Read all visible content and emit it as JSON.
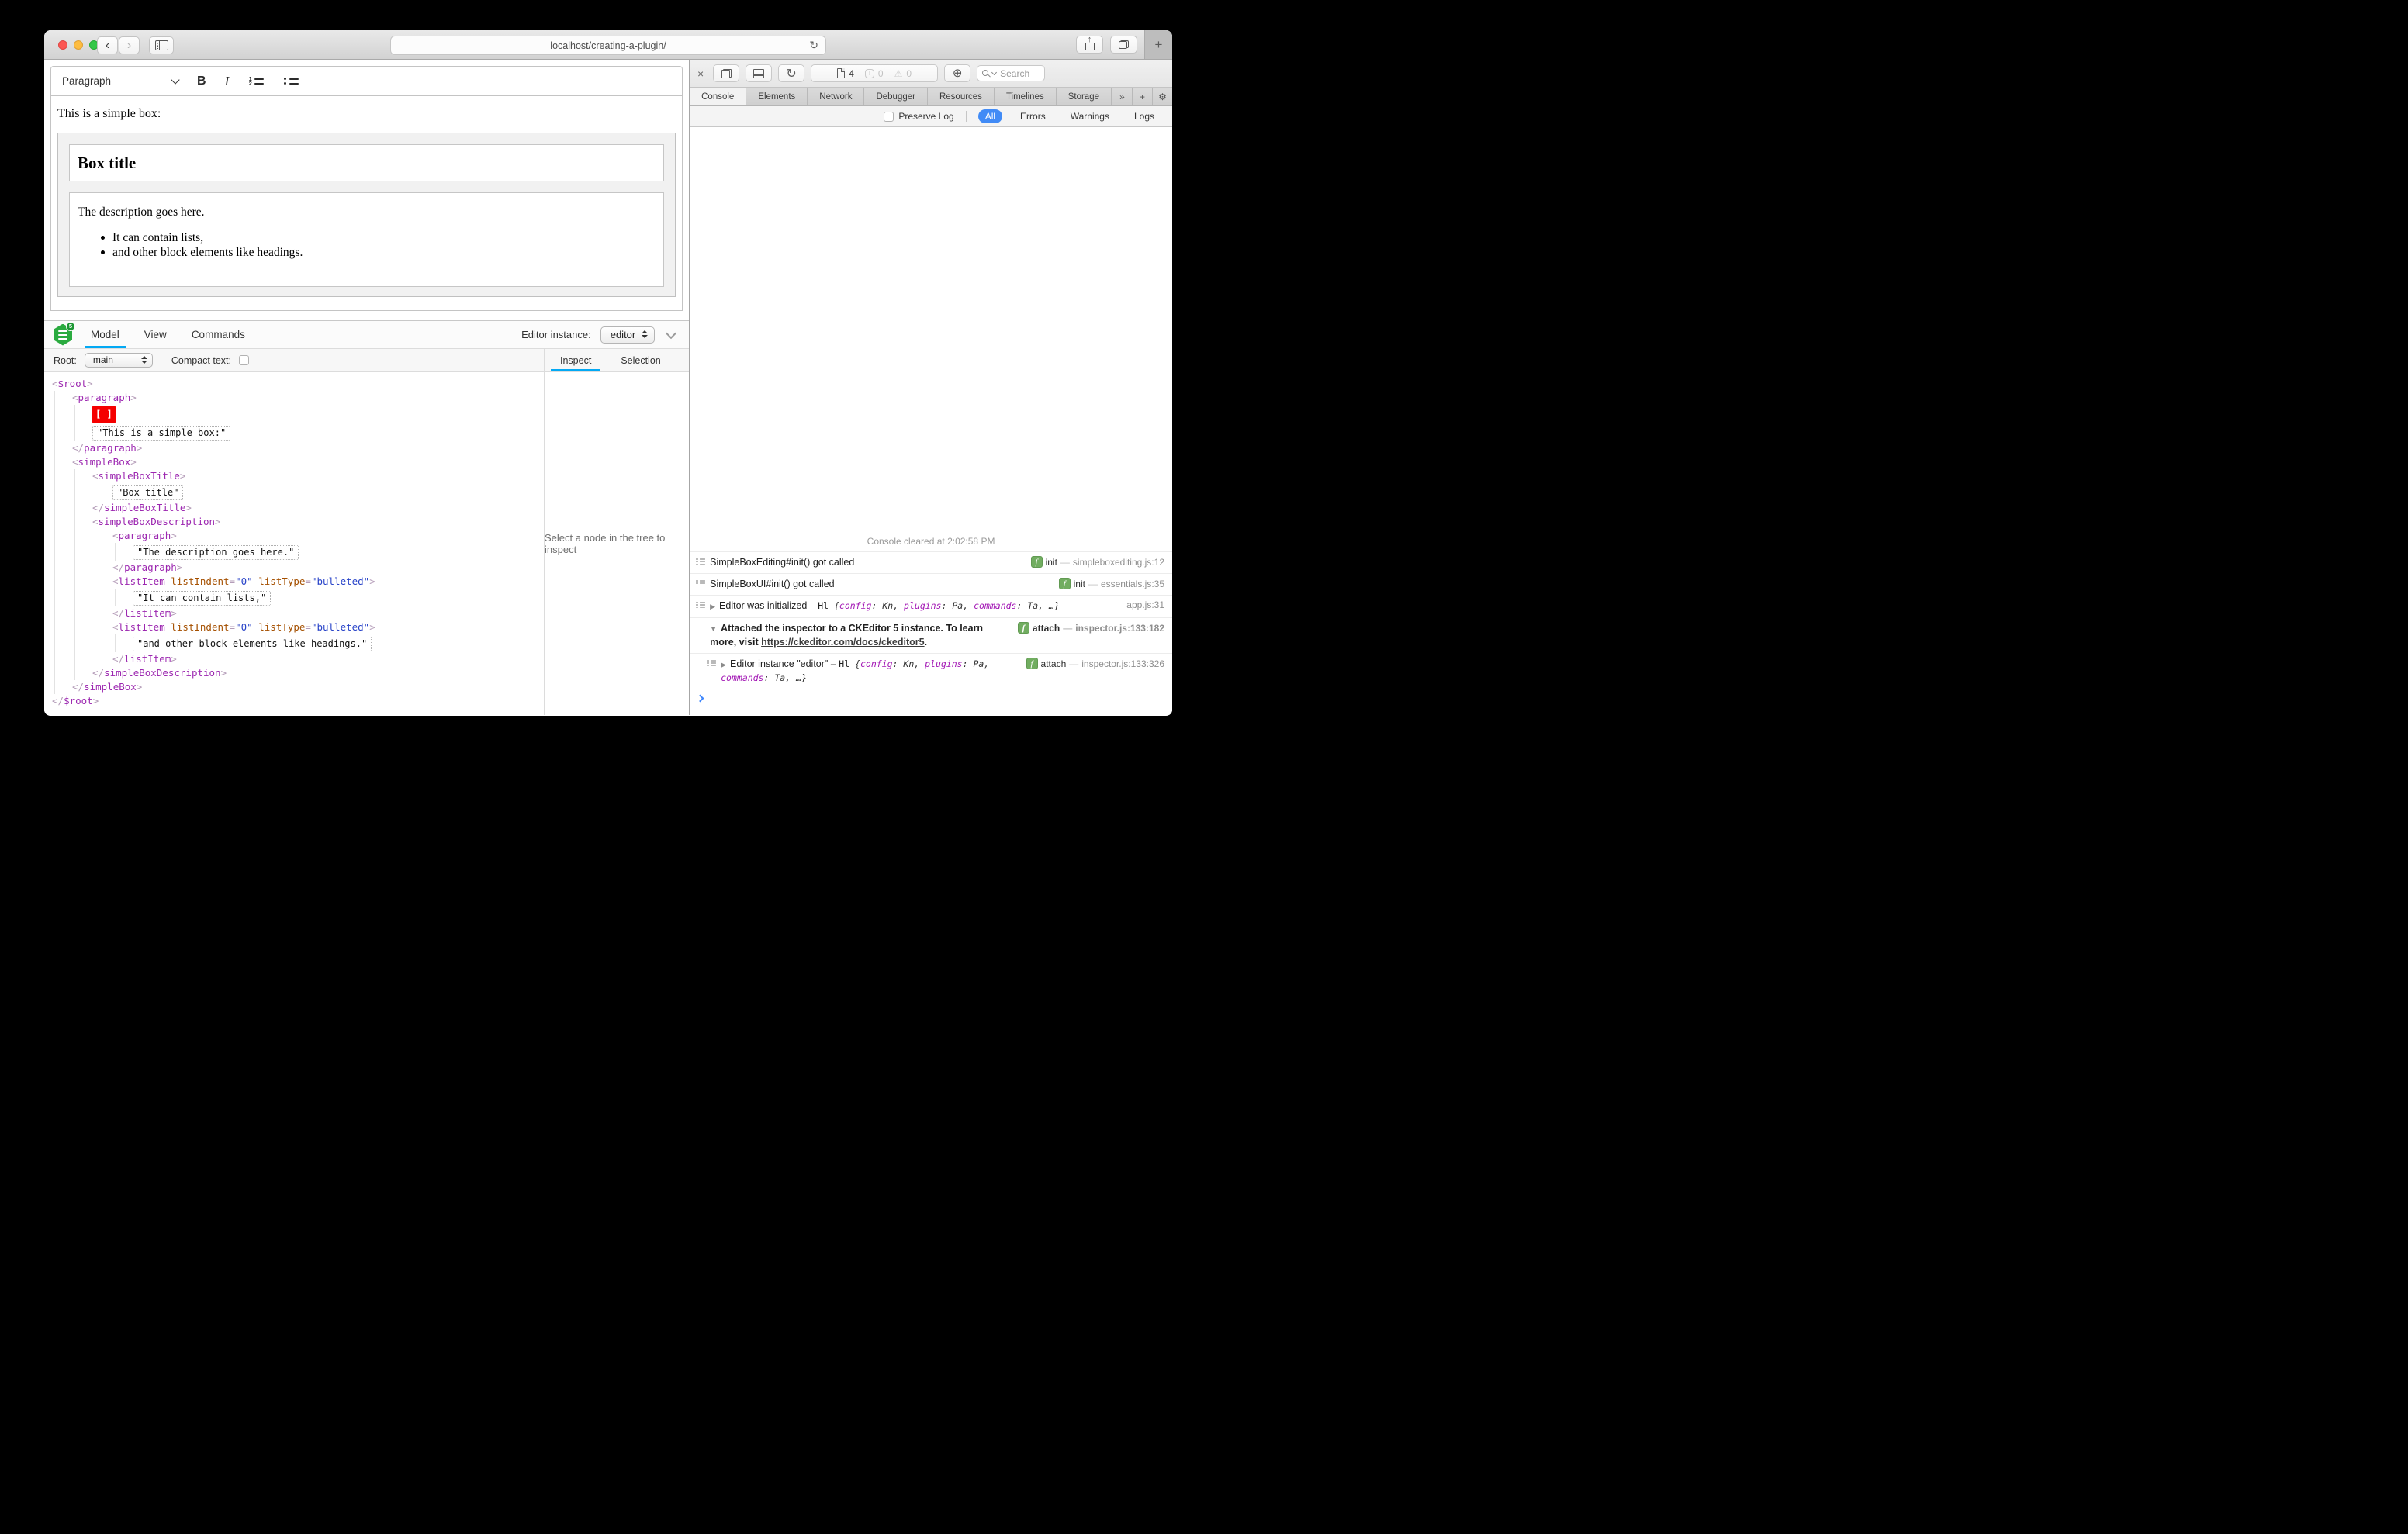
{
  "window": {
    "url": "localhost/creating-a-plugin/",
    "new_tab_label": "+"
  },
  "colors": {
    "accent_blue": "#418bf6",
    "tab_underline_blue": "#03a9f4",
    "selection_red": "#f50000",
    "tag_purple": "#9c27b0",
    "attr_orange": "#a55000",
    "value_blue": "#2742c8",
    "badge_green": "#71ad60",
    "ck_green": "#2bab40"
  },
  "editor": {
    "toolbar": {
      "paragraph_label": "Paragraph",
      "bold_label": "B",
      "italic_label": "I"
    },
    "content": {
      "intro": "This is a simple box:",
      "box_title": "Box title",
      "description": "The description goes here.",
      "bullets": [
        "It can contain lists,",
        "and other block elements like headings."
      ]
    }
  },
  "ck_inspector": {
    "logo_badge": "5",
    "tabs": [
      "Model",
      "View",
      "Commands"
    ],
    "active_tab": "Model",
    "editor_instance_label": "Editor instance:",
    "editor_instance_value": "editor",
    "root_label": "Root:",
    "root_value": "main",
    "compact_label": "Compact text:",
    "side_tabs": [
      "Inspect",
      "Selection"
    ],
    "active_side_tab": "Inspect",
    "empty_message": "Select a node in the tree to inspect",
    "selection_marker": "[ ]",
    "model_tree": [
      {
        "indent": 0,
        "kind": "open",
        "tag": "$root"
      },
      {
        "indent": 1,
        "kind": "open",
        "tag": "paragraph"
      },
      {
        "indent": 2,
        "kind": "selection"
      },
      {
        "indent": 2,
        "kind": "text",
        "value": "This is a simple box:"
      },
      {
        "indent": 1,
        "kind": "close",
        "tag": "paragraph"
      },
      {
        "indent": 1,
        "kind": "open",
        "tag": "simpleBox"
      },
      {
        "indent": 2,
        "kind": "open",
        "tag": "simpleBoxTitle"
      },
      {
        "indent": 3,
        "kind": "text",
        "value": "Box title"
      },
      {
        "indent": 2,
        "kind": "close",
        "tag": "simpleBoxTitle"
      },
      {
        "indent": 2,
        "kind": "open",
        "tag": "simpleBoxDescription"
      },
      {
        "indent": 3,
        "kind": "open",
        "tag": "paragraph"
      },
      {
        "indent": 4,
        "kind": "text",
        "value": "The description goes here."
      },
      {
        "indent": 3,
        "kind": "close",
        "tag": "paragraph"
      },
      {
        "indent": 3,
        "kind": "open",
        "tag": "listItem",
        "attrs": [
          [
            "listIndent",
            "0"
          ],
          [
            "listType",
            "bulleted"
          ]
        ]
      },
      {
        "indent": 4,
        "kind": "text",
        "value": "It can contain lists,"
      },
      {
        "indent": 3,
        "kind": "close",
        "tag": "listItem"
      },
      {
        "indent": 3,
        "kind": "open",
        "tag": "listItem",
        "attrs": [
          [
            "listIndent",
            "0"
          ],
          [
            "listType",
            "bulleted"
          ]
        ]
      },
      {
        "indent": 4,
        "kind": "text",
        "value": "and other block elements like headings."
      },
      {
        "indent": 3,
        "kind": "close",
        "tag": "listItem"
      },
      {
        "indent": 2,
        "kind": "close",
        "tag": "simpleBoxDescription"
      },
      {
        "indent": 1,
        "kind": "close",
        "tag": "simpleBox"
      },
      {
        "indent": 0,
        "kind": "close",
        "tag": "$root"
      }
    ]
  },
  "devtools": {
    "toolbar": {
      "resource_count": "4",
      "error_count": "0",
      "warning_count": "0",
      "search_placeholder": "Search"
    },
    "tabs": [
      "Console",
      "Elements",
      "Network",
      "Debugger",
      "Resources",
      "Timelines",
      "Storage"
    ],
    "active_tab": "Console",
    "filters": {
      "preserve_log_label": "Preserve Log",
      "options": [
        "All",
        "Errors",
        "Warnings",
        "Logs"
      ],
      "active": "All"
    },
    "console": {
      "cleared": "Console cleared at 2:02:58 PM",
      "rows": [
        {
          "icon": true,
          "segments": [
            {
              "k": "plain",
              "v": "SimpleBoxEditing#init() got called"
            }
          ],
          "badge": "init",
          "source": "simpleboxediting.js:12"
        },
        {
          "icon": true,
          "segments": [
            {
              "k": "plain",
              "v": "SimpleBoxUI#init() got called"
            }
          ],
          "badge": "init",
          "source": "essentials.js:35"
        },
        {
          "icon": true,
          "disclosure": "closed",
          "segments": [
            {
              "k": "plain",
              "v": "Editor was initialized"
            },
            {
              "k": "dim",
              "v": " – "
            },
            {
              "k": "cls",
              "v": "Hl "
            },
            {
              "k": "code",
              "v": "{"
            },
            {
              "k": "key",
              "v": "config"
            },
            {
              "k": "code",
              "v": ": "
            },
            {
              "k": "ival",
              "v": "Kn"
            },
            {
              "k": "code",
              "v": ", "
            },
            {
              "k": "key",
              "v": "plugins"
            },
            {
              "k": "code",
              "v": ": "
            },
            {
              "k": "ival",
              "v": "Pa"
            },
            {
              "k": "code",
              "v": ", "
            },
            {
              "k": "key",
              "v": "commands"
            },
            {
              "k": "code",
              "v": ": "
            },
            {
              "k": "ival",
              "v": "Ta"
            },
            {
              "k": "code",
              "v": ", …}"
            }
          ],
          "source": "app.js:31"
        },
        {
          "disclosure": "open",
          "bold": true,
          "segments": [
            {
              "k": "plain",
              "v": "Attached the inspector to a CKEditor 5 instance. To learn more, visit "
            },
            {
              "k": "link",
              "v": "https://ckeditor.com/docs/ckeditor5"
            },
            {
              "k": "plain",
              "v": "."
            }
          ],
          "badge": "attach",
          "source": "inspector.js:133:182"
        },
        {
          "icon": true,
          "nested": true,
          "disclosure": "closed",
          "segments": [
            {
              "k": "plain",
              "v": "Editor instance \"editor\""
            },
            {
              "k": "dim",
              "v": " – "
            },
            {
              "k": "cls",
              "v": "Hl "
            },
            {
              "k": "code",
              "v": "{"
            },
            {
              "k": "key",
              "v": "config"
            },
            {
              "k": "code",
              "v": ": "
            },
            {
              "k": "ival",
              "v": "Kn"
            },
            {
              "k": "code",
              "v": ", "
            },
            {
              "k": "key",
              "v": "plugins"
            },
            {
              "k": "code",
              "v": ": "
            },
            {
              "k": "ival",
              "v": "Pa"
            },
            {
              "k": "code",
              "v": ", "
            },
            {
              "k": "key",
              "v": "commands"
            },
            {
              "k": "code",
              "v": ": "
            },
            {
              "k": "ival",
              "v": "Ta"
            },
            {
              "k": "code",
              "v": ", …}"
            }
          ],
          "badge": "attach",
          "source": "inspector.js:133:326"
        }
      ]
    }
  }
}
